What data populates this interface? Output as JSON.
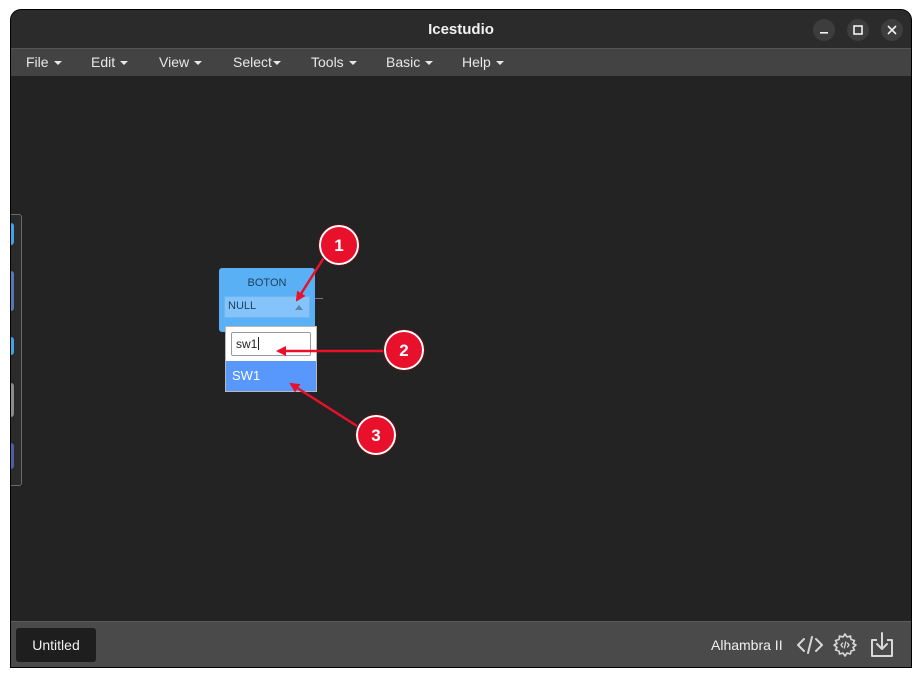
{
  "window": {
    "title": "Icestudio"
  },
  "menubar": {
    "items": [
      {
        "label": "File"
      },
      {
        "label": "Edit"
      },
      {
        "label": "View"
      },
      {
        "label": "Select"
      },
      {
        "label": "Tools"
      },
      {
        "label": "Basic"
      },
      {
        "label": "Help"
      }
    ]
  },
  "block": {
    "title": "BOTON",
    "selected_value": "NULL",
    "dropdown": {
      "search_value": "sw1",
      "option": "SW1"
    }
  },
  "annotations": [
    {
      "label": "1"
    },
    {
      "label": "2"
    },
    {
      "label": "3"
    }
  ],
  "statusbar": {
    "tab_label": "Untitled",
    "board": "Alhambra II"
  },
  "colors": {
    "block": "#5ab0f5",
    "option_highlight": "#5897fb",
    "annotation_red": "#e8102a"
  }
}
